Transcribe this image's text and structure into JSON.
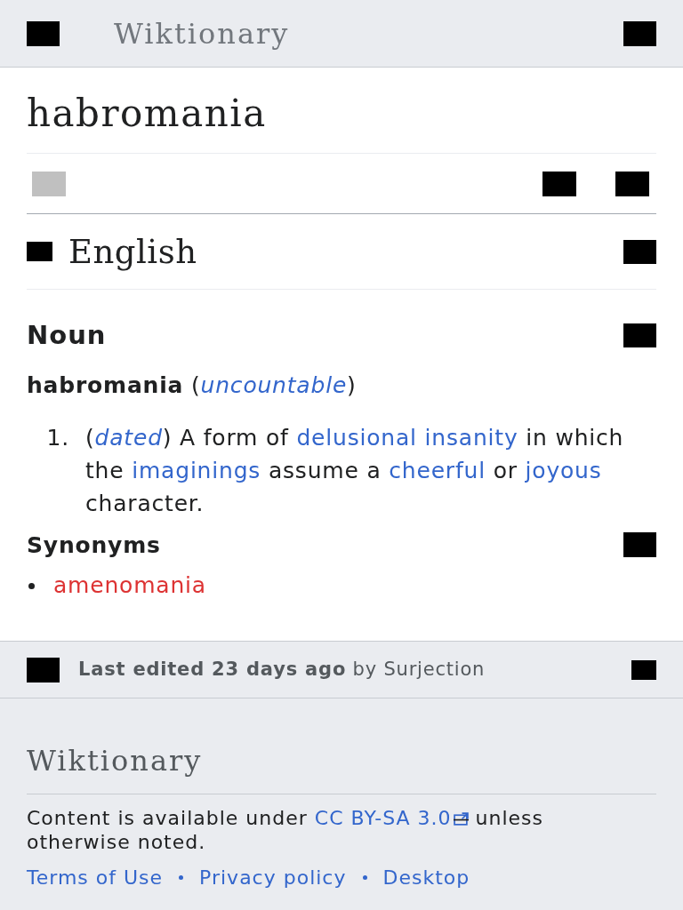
{
  "header": {
    "title": "Wiktionary"
  },
  "page": {
    "title": "habromania",
    "actions": [
      {
        "disabled": true
      },
      {
        "disabled": false
      },
      {
        "disabled": false
      }
    ]
  },
  "language_section": {
    "heading": "English"
  },
  "noun": {
    "heading": "Noun",
    "headword_line": [
      {
        "kind": "headword",
        "text": "habromania"
      },
      {
        "kind": "text",
        "text": " ("
      },
      {
        "kind": "qualifier",
        "text": "uncountable"
      },
      {
        "kind": "text",
        "text": ")"
      }
    ],
    "definitions": [
      {
        "number": "1.",
        "segments": [
          {
            "kind": "text",
            "text": "("
          },
          {
            "kind": "qualifier",
            "text": "dated"
          },
          {
            "kind": "text",
            "text": ") A form of "
          },
          {
            "kind": "link",
            "text": "delusional insanity"
          },
          {
            "kind": "text",
            "text": " in which the "
          },
          {
            "kind": "link",
            "text": "imaginings"
          },
          {
            "kind": "text",
            "text": " assume a "
          },
          {
            "kind": "link",
            "text": "cheerful"
          },
          {
            "kind": "text",
            "text": " or "
          },
          {
            "kind": "link",
            "text": "joyous"
          },
          {
            "kind": "text",
            "text": " character."
          }
        ]
      }
    ]
  },
  "synonyms": {
    "heading": "Synonyms",
    "items": [
      {
        "text": "amenomania",
        "missing": true
      }
    ]
  },
  "last_edited": "**Last edited 23 days ago** by Surjection",
  "footer": {
    "title": "Wiktionary",
    "license": [
      {
        "kind": "text",
        "text": "Content is available under "
      },
      {
        "kind": "external_link",
        "text": "CC BY-SA 3.0"
      },
      {
        "kind": "text",
        "text": " unless otherwise noted."
      }
    ],
    "links": [
      "Terms of Use",
      "Privacy policy",
      "Desktop"
    ]
  }
}
